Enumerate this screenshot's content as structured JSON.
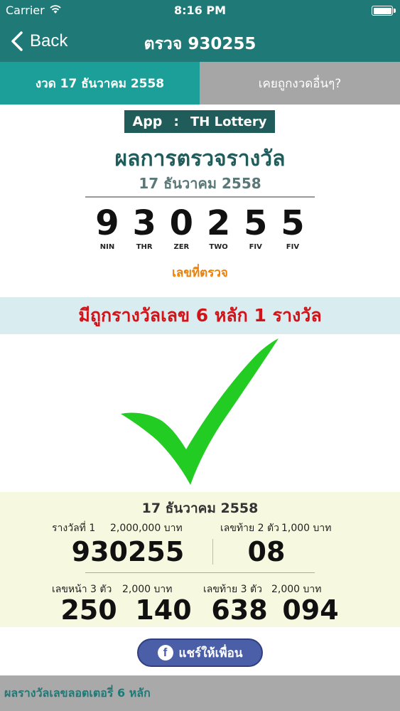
{
  "status_bar": {
    "carrier": "Carrier",
    "time": "8:16 PM",
    "battery_level": 1.0
  },
  "nav": {
    "back_label": "Back",
    "title": "ตรวจ 930255"
  },
  "tabs": [
    {
      "label": "งวด 17 ธันวาคม 2558",
      "active": true
    },
    {
      "label": "เคยถูกงวดอื่นๆ?",
      "active": false
    }
  ],
  "badge": {
    "app_label": "App",
    "separator": ":",
    "app_name": "TH Lottery"
  },
  "heading": "ผลการตรวจรางวัล",
  "draw_date": "17 ธันวาคม 2558",
  "ticket_digits": [
    {
      "num": "9",
      "word": "NIN"
    },
    {
      "num": "3",
      "word": "THR"
    },
    {
      "num": "0",
      "word": "ZER"
    },
    {
      "num": "2",
      "word": "TWO"
    },
    {
      "num": "5",
      "word": "FIV"
    },
    {
      "num": "5",
      "word": "FIV"
    }
  ],
  "checked_label": "เลขที่ตรวจ",
  "result_text": "มีถูกรางวัลเลข 6 หลัก 1 รางวัล",
  "result_icon": "checkmark-icon",
  "prizes": {
    "date": "17 ธันวาคม 2558",
    "first": {
      "label": "รางวัลที่ 1",
      "amount": "2,000,000 บาท",
      "number": "930255"
    },
    "last2": {
      "label": "เลขท้าย 2 ตัว",
      "amount": "1,000 บาท",
      "number": "08"
    },
    "front3": {
      "label": "เลขหน้า 3 ตัว",
      "amount": "2,000 บาท",
      "numbers": [
        "250",
        "140"
      ]
    },
    "last3": {
      "label": "เลขท้าย 3 ตัว",
      "amount": "2,000 บาท",
      "numbers": [
        "638",
        "094"
      ]
    }
  },
  "share_label": "แชร์ให้เพื่อน",
  "footer_text": "ผลรางวัลเลขลอตเตอรี่ 6 หลัก",
  "colors": {
    "primary": "#1f7a77",
    "tab_active": "#1c9f98",
    "result_red": "#d0141a",
    "check_green": "#22cc22",
    "accent_orange": "#e8820c"
  }
}
